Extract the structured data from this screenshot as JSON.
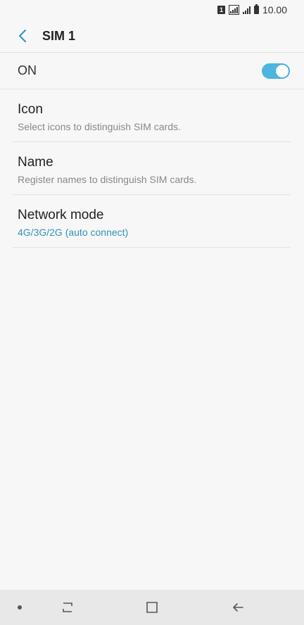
{
  "status_bar": {
    "sim_indicator": "1",
    "time": "10.00"
  },
  "header": {
    "title": "SIM 1",
    "back_icon": "back-arrow-icon"
  },
  "toggle": {
    "label": "ON",
    "state": true,
    "accent_color": "#4db6e0"
  },
  "settings": [
    {
      "title": "Icon",
      "subtitle": "Select icons to distinguish SIM cards."
    },
    {
      "title": "Name",
      "subtitle": "Register names to distinguish SIM cards."
    },
    {
      "title": "Network mode",
      "subtitle": "4G/3G/2G (auto connect)"
    }
  ],
  "nav_bar": {
    "dot_icon": "dot-icon",
    "recent_icon": "recent-apps-icon",
    "home_icon": "home-icon",
    "back_icon": "back-nav-icon"
  }
}
